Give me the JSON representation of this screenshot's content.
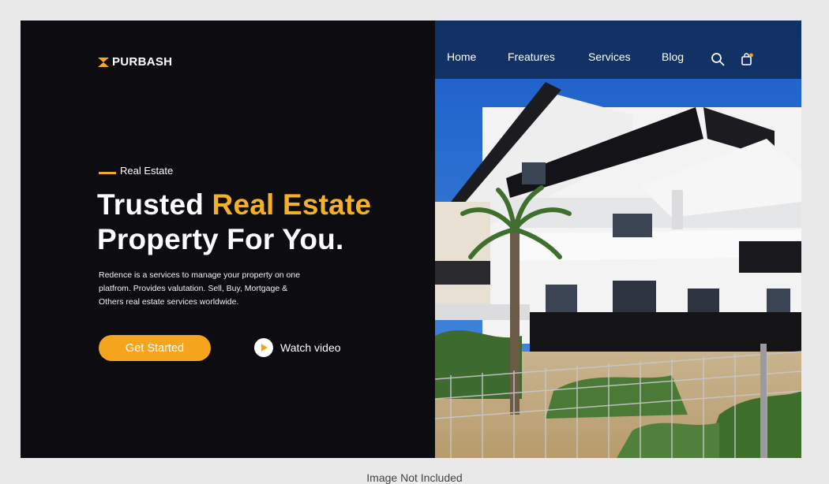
{
  "brand": {
    "logo_text": "PURBASH"
  },
  "nav": {
    "items": [
      {
        "label": "Home"
      },
      {
        "label": "Freatures"
      },
      {
        "label": "Services"
      },
      {
        "label": "Blog"
      }
    ],
    "icons": [
      "search-icon",
      "shopping-bag-icon"
    ]
  },
  "hero": {
    "kicker": "Real Estate",
    "title_line1_a": "Trusted ",
    "title_line1_b": "Real Estate",
    "title_line2": "Property For You.",
    "description_lines": [
      "Redence is a services to manage your property on one",
      "platfrom. Provides valutation. Sell, Buy, Mortgage &",
      "Others real estate services worldwide."
    ],
    "cta_label": "Get Started",
    "video_label": "Watch video"
  },
  "footer": {
    "note": "Image Not Included"
  },
  "colors": {
    "background": "#0d0c10",
    "accent": "#f5a41d",
    "nav_overlay": "#0e203e"
  }
}
